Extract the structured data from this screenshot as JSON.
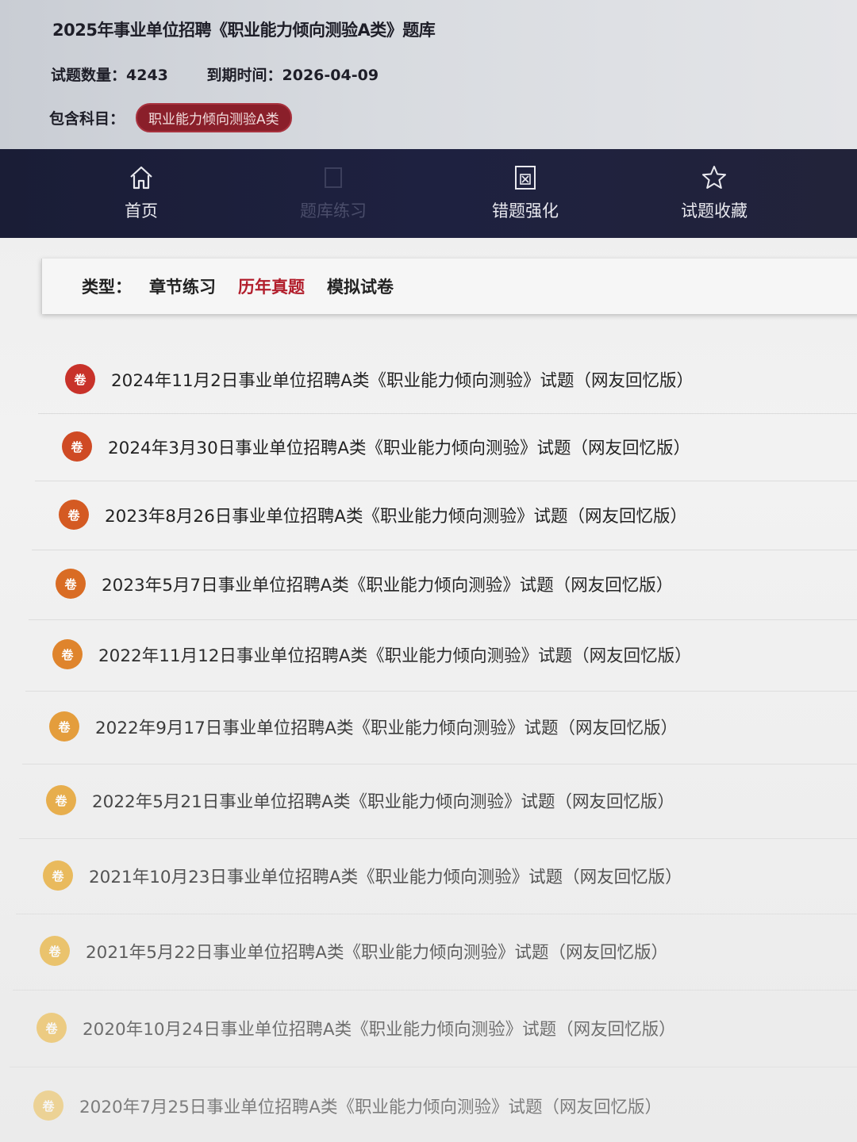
{
  "header": {
    "title": "2025年事业单位招聘《职业能力倾向测验A类》题库",
    "question_count": "试题数量：4243",
    "expire": "到期时间：2026-04-09",
    "subject_label": "包含科目：",
    "subject_badge": "职业能力倾向测验A类"
  },
  "nav": {
    "items": [
      {
        "label": "首页",
        "icon": "home-icon"
      },
      {
        "label": "题库练习",
        "icon": "book-icon"
      },
      {
        "label": "错题强化",
        "icon": "wrong-icon"
      },
      {
        "label": "试题收藏",
        "icon": "star-icon"
      }
    ]
  },
  "type_filter": {
    "label": "类型：",
    "options": [
      "章节练习",
      "历年真题",
      "模拟试卷"
    ],
    "active": "历年真题",
    "active_color": "#b21e2c"
  },
  "papers": {
    "badge_text": "卷",
    "items": [
      "2024年11月2日事业单位招聘A类《职业能力倾向测验》试题（网友回忆版）",
      "2024年3月30日事业单位招聘A类《职业能力倾向测验》试题（网友回忆版）",
      "2023年8月26日事业单位招聘A类《职业能力倾向测验》试题（网友回忆版）",
      "2023年5月7日事业单位招聘A类《职业能力倾向测验》试题（网友回忆版）",
      "2022年11月12日事业单位招聘A类《职业能力倾向测验》试题（网友回忆版）",
      "2022年9月17日事业单位招聘A类《职业能力倾向测验》试题（网友回忆版）",
      "2022年5月21日事业单位招聘A类《职业能力倾向测验》试题（网友回忆版）",
      "2021年10月23日事业单位招聘A类《职业能力倾向测验》试题（网友回忆版）",
      "2021年5月22日事业单位招聘A类《职业能力倾向测验》试题（网友回忆版）",
      "2020年10月24日事业单位招聘A类《职业能力倾向测验》试题（网友回忆版）",
      "2020年7月25日事业单位招聘A类《职业能力倾向测验》试题（网友回忆版）"
    ],
    "badge_colors": [
      "#c8322a",
      "#cf4a24",
      "#d45a22",
      "#d96a20",
      "#de7e20",
      "#e39224",
      "#e6a02a",
      "#e8aa30",
      "#eab238",
      "#ecb842",
      "#eebf50"
    ]
  }
}
